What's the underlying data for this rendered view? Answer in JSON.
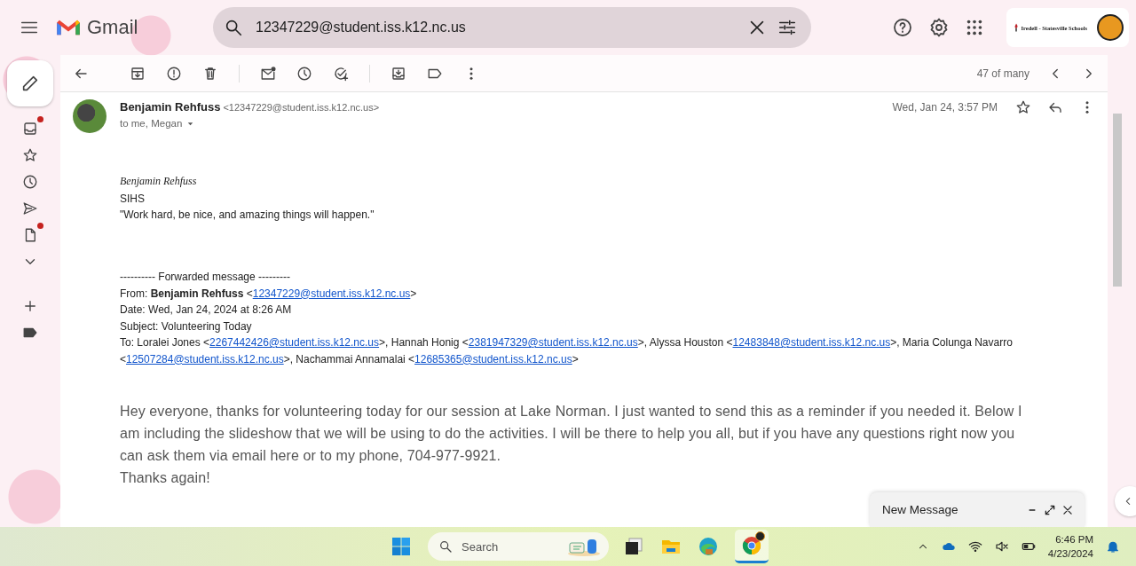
{
  "topbar": {
    "app_name": "Gmail",
    "search": {
      "value": "12347229@student.iss.k12.nc.us"
    },
    "account": {
      "organization": "Iredell - Statesville Schools"
    }
  },
  "sidebar": {
    "items": [
      {
        "kind": "inbox",
        "notification_dot": true
      },
      {
        "kind": "starred",
        "notification_dot": false
      },
      {
        "kind": "snoozed",
        "notification_dot": false
      },
      {
        "kind": "sent",
        "notification_dot": false
      },
      {
        "kind": "drafts",
        "notification_dot": true
      },
      {
        "kind": "more",
        "notification_dot": false
      },
      {
        "kind": "add",
        "notification_dot": false
      },
      {
        "kind": "label",
        "notification_dot": false
      }
    ]
  },
  "toolbar": {
    "position": "47 of many"
  },
  "message": {
    "sender_name": "Benjamin Rehfuss",
    "sender_email": "<12347229@student.iss.k12.nc.us>",
    "recipients": "to me, Megan",
    "date": "Wed, Jan 24, 3:57 PM",
    "starred": false,
    "signature": [
      {
        "kind": "name",
        "text": "Benjamin Rehfuss"
      },
      {
        "kind": "plain",
        "text": "SIHS"
      },
      {
        "kind": "plain",
        "text": "\"Work hard, be nice, and amazing things will happen.\""
      }
    ],
    "forwarded": {
      "header": "---------- Forwarded message ---------",
      "lines": [
        [
          {
            "kind": "text",
            "text": "From: "
          },
          {
            "kind": "bold",
            "text": "Benjamin Rehfuss"
          },
          {
            "kind": "text",
            "text": " <"
          },
          {
            "kind": "link",
            "text": "12347229@student.iss.k12.nc.us"
          },
          {
            "kind": "text",
            "text": ">"
          }
        ],
        [
          {
            "kind": "text",
            "text": "Date: Wed, Jan 24, 2024 at 8:26 AM"
          }
        ],
        [
          {
            "kind": "text",
            "text": "Subject: Volunteering Today"
          }
        ],
        [
          {
            "kind": "text",
            "text": "To: Loralei Jones <"
          },
          {
            "kind": "link",
            "text": "2267442426@student.iss.k12.nc.us"
          },
          {
            "kind": "text",
            "text": ">, Hannah Honig <"
          },
          {
            "kind": "link",
            "text": "2381947329@student.iss.k12.nc.us"
          },
          {
            "kind": "text",
            "text": ">, Alyssa Houston <"
          },
          {
            "kind": "link",
            "text": "12483848@student.iss.k12.nc.us"
          },
          {
            "kind": "text",
            "text": ">, Maria Colunga Navarro <"
          },
          {
            "kind": "link",
            "text": "12507284@student.iss.k12.nc.us"
          },
          {
            "kind": "text",
            "text": ">, Nachammai Annamalai <"
          },
          {
            "kind": "link",
            "text": "12685365@student.iss.k12.nc.us"
          },
          {
            "kind": "text",
            "text": ">"
          }
        ]
      ]
    },
    "body": [
      "Hey everyone, thanks for volunteering today for our session at Lake Norman. I just wanted to send this as a reminder if you needed it. Below I am including the slideshow that we will be using to do the activities. I will be there to help you all, but if you have any questions right now you can ask them via email here or to my phone, 704-977-9921.",
      "Thanks again!"
    ]
  },
  "compose": {
    "title": "New Message"
  },
  "taskbar": {
    "search": {
      "placeholder": "Search"
    },
    "time": "6:46 PM",
    "date": "4/23/2024"
  }
}
